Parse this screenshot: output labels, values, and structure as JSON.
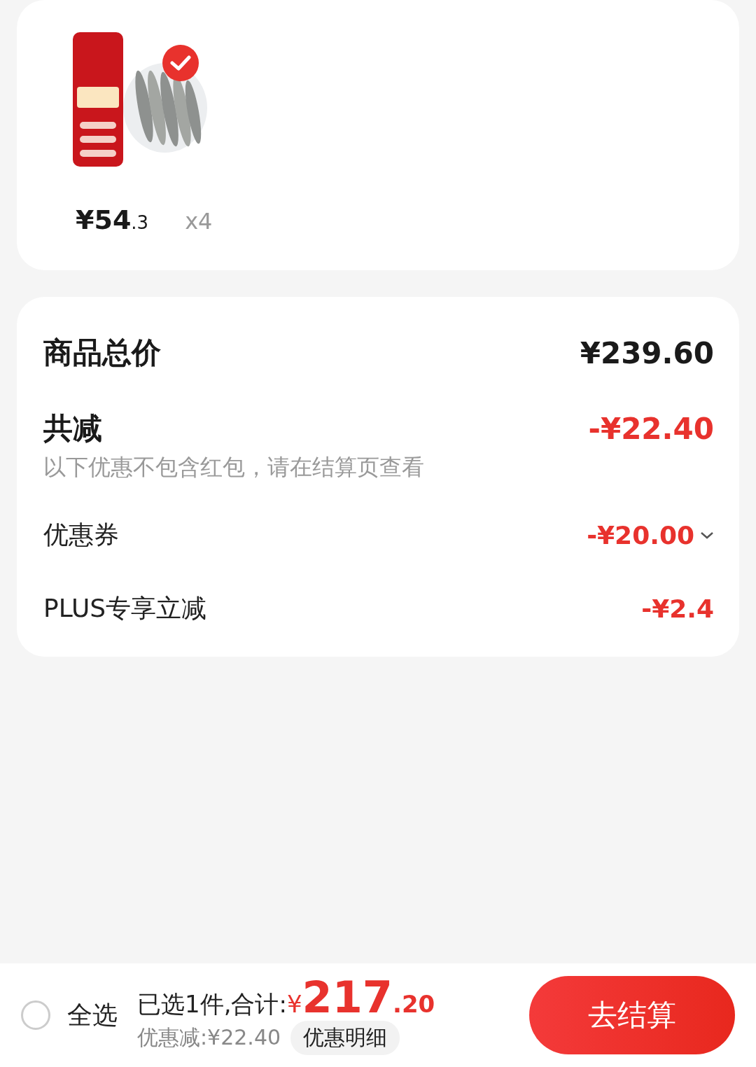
{
  "product": {
    "kind": "picture",
    "selected": true,
    "price_integer": "¥54",
    "price_decimal": ".3",
    "quantity": "x4"
  },
  "summary": {
    "total_label": "商品总价",
    "total_value": "¥239.60",
    "discount_label": "共减",
    "discount_value": "-¥22.40",
    "note": "以下优惠不包含红包，请在结算页查看",
    "items": [
      {
        "label": "优惠券",
        "value": "-¥20.00",
        "kind": "expandable"
      },
      {
        "label": "PLUS专享立减",
        "value": "-¥2.4",
        "kind": "plain"
      }
    ]
  },
  "bottom_bar": {
    "select_all": {
      "label": "全选",
      "checked": false
    },
    "selected_count": "已选1件,合计:",
    "currency": "¥",
    "total_integer": "217",
    "total_decimal": ".20",
    "saved": "优惠减:¥22.40",
    "detail_button": "优惠明细",
    "checkout_button": "去结算"
  }
}
